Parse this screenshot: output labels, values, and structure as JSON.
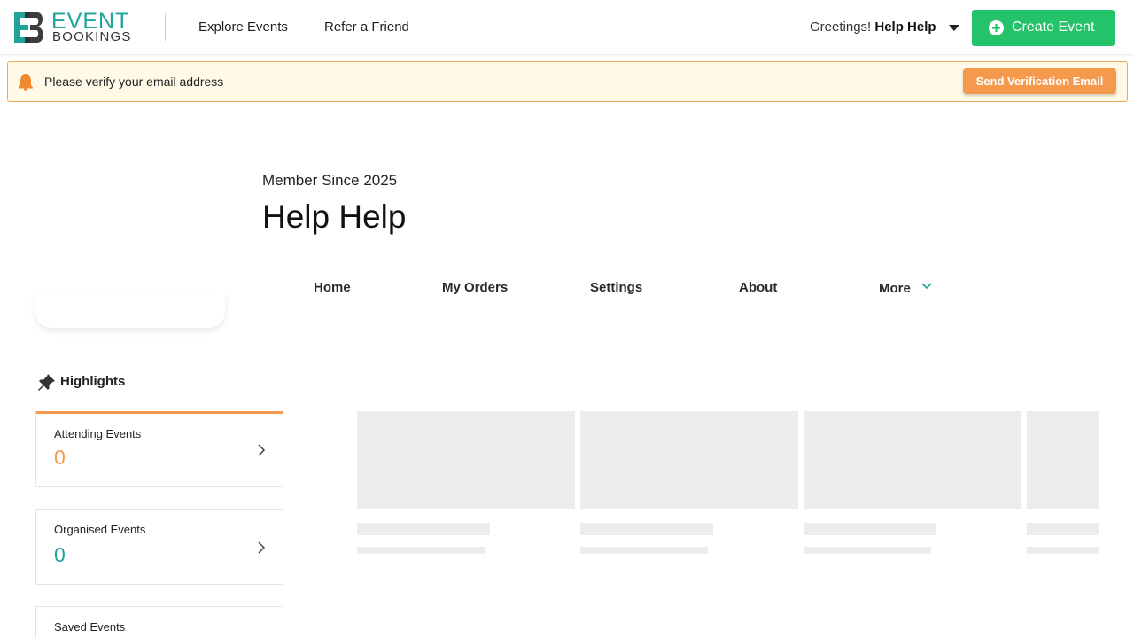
{
  "brand": {
    "line1": "EVENT",
    "line2": "BOOKINGS",
    "logo_letters": "EB",
    "teal": "#1fa39a"
  },
  "nav": {
    "explore": "Explore Events",
    "refer": "Refer a Friend"
  },
  "user_menu": {
    "greeting": "Greetings!",
    "name": "Help Help"
  },
  "create_event": {
    "label": "Create Event",
    "color": "#24c36a"
  },
  "banner": {
    "message": "Please verify your email address",
    "button": "Send Verification Email",
    "accent": "#f59a4d",
    "icon": "bell-icon"
  },
  "profile": {
    "member_since": "Member Since 2025",
    "name": "Help Help"
  },
  "tabs": [
    {
      "label": "Home"
    },
    {
      "label": "My Orders"
    },
    {
      "label": "Settings"
    },
    {
      "label": "About"
    },
    {
      "label": "More"
    }
  ],
  "highlights": {
    "title": "Highlights",
    "icon": "pin-icon",
    "cards": [
      {
        "label": "Attending Events",
        "value": "0",
        "color": "#f59a4d"
      },
      {
        "label": "Organised Events",
        "value": "0",
        "color": "#1fa39a"
      },
      {
        "label": "Saved Events",
        "value": ""
      }
    ]
  }
}
